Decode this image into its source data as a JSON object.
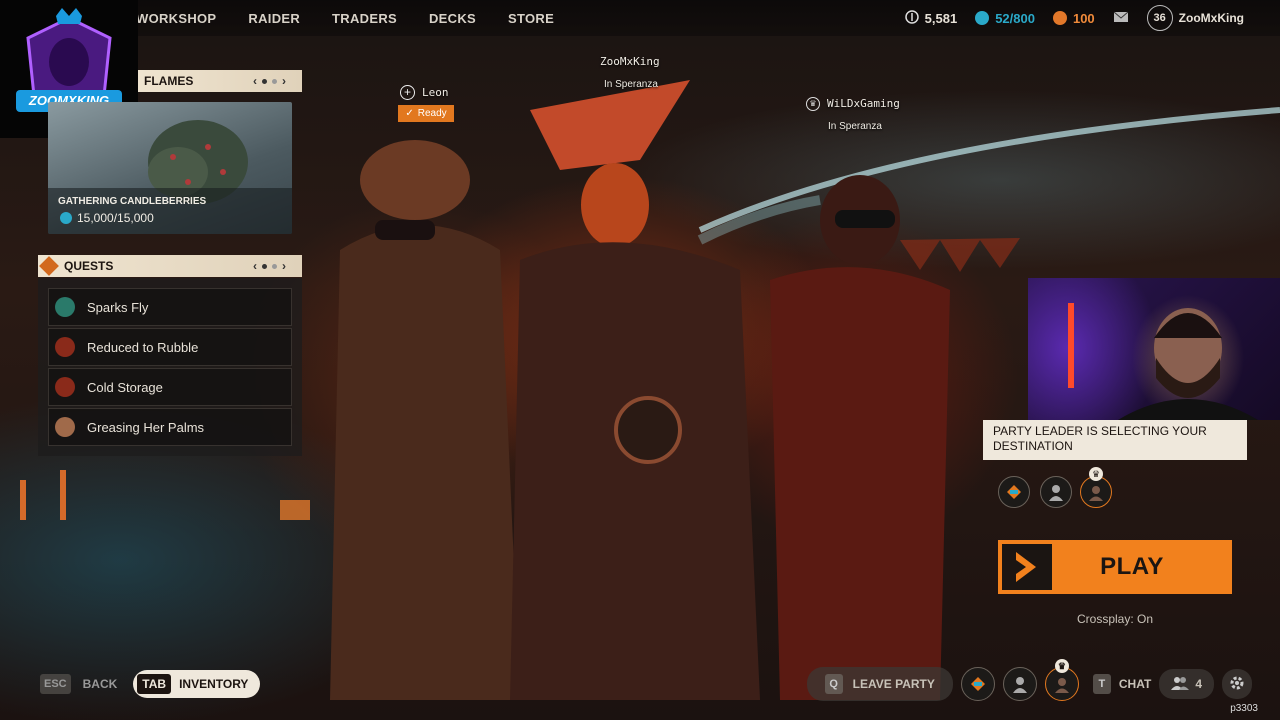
{
  "nav": {
    "items": [
      "WORKSHOP",
      "RAIDER",
      "TRADERS",
      "DECKS",
      "STORE"
    ]
  },
  "stats": {
    "coins": "5,581",
    "tokens": "52/800",
    "cred": "100",
    "level": "36",
    "username": "ZooMxKing"
  },
  "logo": {
    "text": "ZOOMXKING"
  },
  "event": {
    "header": "FLAMES",
    "card_title": "GATHERING CANDLEBERRIES",
    "progress_text": "15,000/15,000",
    "progress": 1.0
  },
  "quests": {
    "header": "QUESTS",
    "items": [
      "Sparks Fly",
      "Reduced to Rubble",
      "Cold Storage",
      "Greasing Her Palms"
    ]
  },
  "players": {
    "left": {
      "name": "Leon",
      "status": "Ready"
    },
    "center": {
      "name": "ZooMxKing",
      "location": "In Speranza"
    },
    "right": {
      "name": "WiLDxGaming",
      "location": "In Speranza"
    }
  },
  "party": {
    "message": "PARTY LEADER IS SELECTING YOUR DESTINATION",
    "play_label": "PLAY",
    "crossplay": "Crossplay: On"
  },
  "bottom": {
    "esc_key": "ESC",
    "back_label": "BACK",
    "tab_key": "TAB",
    "inventory_label": "INVENTORY",
    "q_key": "Q",
    "leave_party_label": "LEAVE PARTY",
    "t_key": "T",
    "chat_label": "CHAT",
    "party_count": "4"
  },
  "footer_code": "p3303",
  "colors": {
    "accent": "#f2811d",
    "panel_cream": "#efe4d0",
    "token_blue": "#2aa9c9"
  }
}
